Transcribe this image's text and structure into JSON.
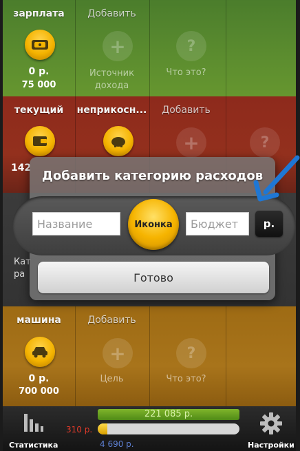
{
  "income": {
    "cells": [
      {
        "title": "зарплата",
        "amount": "0 р.",
        "budget": "75 000"
      },
      {
        "title": "Добавить",
        "caption": "Источник дохода"
      },
      {
        "caption": "Что это?"
      }
    ]
  },
  "accounts": {
    "cells": [
      {
        "title": "текущий",
        "amount_partial": "142"
      },
      {
        "title": "неприкосн..."
      },
      {
        "title": "Добавить"
      }
    ]
  },
  "expenses_hidden": {
    "left_partial_line1": "Кат",
    "left_partial_line2": "ра"
  },
  "goals": {
    "cells": [
      {
        "title": "машина",
        "amount": "0 р.",
        "budget": "700 000"
      },
      {
        "title": "Добавить",
        "caption": "Цель"
      },
      {
        "caption": "Что это?"
      }
    ]
  },
  "dialog": {
    "title": "Добавить категорию расходов",
    "name_placeholder": "Название",
    "icon_label": "Иконка",
    "budget_placeholder": "Бюджет",
    "currency_label": "р.",
    "done_label": "Готово"
  },
  "bottom": {
    "stats_label": "Статистика",
    "settings_label": "Настройки",
    "total_amount": "221 085 р.",
    "over_amount": "310 р.",
    "spent_amount": "4 690 р."
  },
  "colors": {
    "income": "#5c8d2f",
    "accounts": "#93301d",
    "goals": "#a8741b",
    "accent": "#f4b300",
    "arrow": "#1f77d4"
  }
}
